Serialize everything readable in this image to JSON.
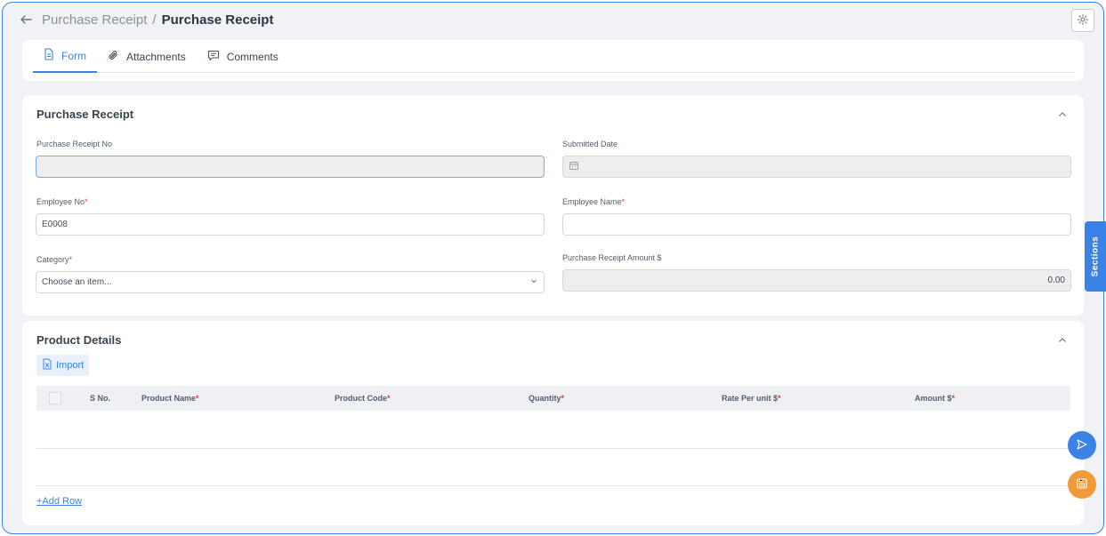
{
  "header": {
    "parent": "Purchase Receipt",
    "separator": "/",
    "current": "Purchase Receipt"
  },
  "tabs": [
    {
      "label": "Form",
      "icon": "document-icon",
      "active": true
    },
    {
      "label": "Attachments",
      "icon": "paperclip-icon",
      "active": false
    },
    {
      "label": "Comments",
      "icon": "comment-icon",
      "active": false
    }
  ],
  "purchase_receipt": {
    "title": "Purchase Receipt",
    "receipt_no": {
      "label": "Purchase Receipt No",
      "value": ""
    },
    "submitted_date": {
      "label": "Submitted Date",
      "value": ""
    },
    "employee_no": {
      "label": "Employee No",
      "value": "E0008"
    },
    "employee_name": {
      "label": "Employee Name",
      "value": ""
    },
    "category": {
      "label": "Category",
      "placeholder": "Choose an item..."
    },
    "amount": {
      "label": "Purchase Receipt Amount $",
      "value": "0.00"
    }
  },
  "product_details": {
    "title": "Product Details",
    "import_label": "Import",
    "columns": [
      "S No.",
      "Product Name",
      "Product Code",
      "Quantity",
      "Rate Per unit $",
      "Amount $"
    ],
    "add_row_label": "+Add Row"
  },
  "sections_label": "Sections",
  "colors": {
    "accent": "#3b82e6",
    "save": "#f29a3a",
    "required": "#e03b3b"
  }
}
